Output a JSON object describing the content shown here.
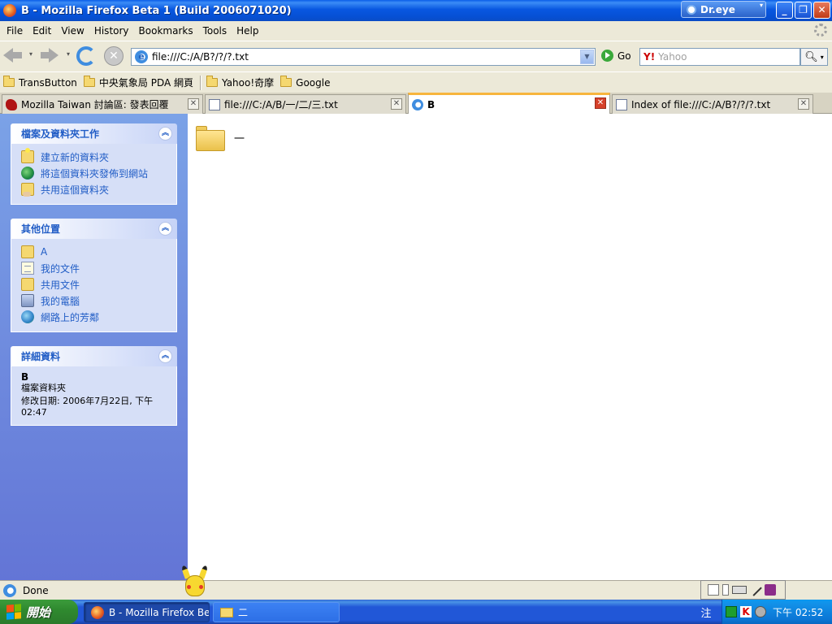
{
  "window": {
    "title": "B - Mozilla Firefox Beta 1 (Build 2006071020)",
    "drEye": "Dr.eye",
    "minimize": "_",
    "maximize": "❐",
    "close": "✕"
  },
  "menu": [
    "File",
    "Edit",
    "View",
    "History",
    "Bookmarks",
    "Tools",
    "Help"
  ],
  "nav": {
    "url": "file:///C:/A/B?/?/?.txt",
    "go": "Go",
    "searchEngine": "Y!",
    "searchPlaceholder": "Yahoo"
  },
  "bookmarks": [
    "TransButton",
    "中央氣象局 PDA 網頁",
    "Yahoo!奇摩",
    "Google"
  ],
  "tabs": [
    {
      "label": "Mozilla Taiwan 討論區: 發表回覆",
      "icon": "dino-icon",
      "active": false
    },
    {
      "label": "file:///C:/A/B/一/二/三.txt",
      "icon": "page-icon",
      "active": false
    },
    {
      "label": "B",
      "icon": "ie-icon",
      "active": true
    },
    {
      "label": "Index of file:///C:/A/B?/?/?.txt",
      "icon": "page-icon",
      "active": false
    }
  ],
  "sidebar": {
    "tasks": {
      "title": "檔案及資料夾工作",
      "items": [
        "建立新的資料夾",
        "將這個資料夾發佈到網站",
        "共用這個資料夾"
      ]
    },
    "places": {
      "title": "其他位置",
      "items": [
        "A",
        "我的文件",
        "共用文件",
        "我的電腦",
        "網路上的芳鄰"
      ]
    },
    "details": {
      "title": "詳細資料",
      "name": "B",
      "type": "檔案資料夾",
      "modified": "修改日期: 2006年7月22日, 下午 02:47"
    }
  },
  "main": {
    "folders": [
      "一"
    ]
  },
  "status": {
    "text": "Done"
  },
  "taskbar": {
    "start": "開始",
    "tasks": [
      {
        "label": "B - Mozilla Firefox Be...",
        "active": true
      },
      {
        "label": "二",
        "active": false
      }
    ],
    "ime": "注",
    "clock": "下午 02:52"
  }
}
